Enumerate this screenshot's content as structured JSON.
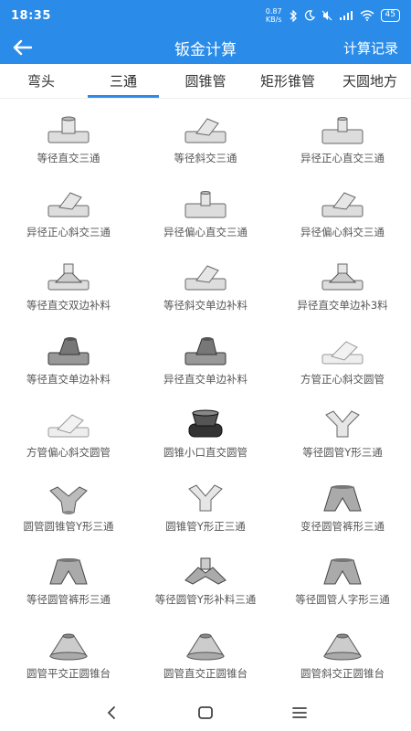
{
  "status": {
    "time": "18:35",
    "net_speed_value": "0.87",
    "net_speed_unit": "KB/s",
    "battery": "45"
  },
  "appbar": {
    "title": "钣金计算",
    "history_label": "计算记录"
  },
  "tabs": [
    {
      "label": "弯头"
    },
    {
      "label": "三通"
    },
    {
      "label": "圆锥管"
    },
    {
      "label": "矩形锥管"
    },
    {
      "label": "天圆地方"
    }
  ],
  "active_tab": "三通",
  "items": [
    {
      "label": "等径直交三通",
      "icon": "tee-straight-icon"
    },
    {
      "label": "等径斜交三通",
      "icon": "tee-oblique-icon"
    },
    {
      "label": "异径正心直交三通",
      "icon": "tee-reducing-icon"
    },
    {
      "label": "异径正心斜交三通",
      "icon": "tee-oblique-icon"
    },
    {
      "label": "异径偏心直交三通",
      "icon": "tee-reducing-icon"
    },
    {
      "label": "异径偏心斜交三通",
      "icon": "tee-oblique-icon"
    },
    {
      "label": "等径直交双边补料",
      "icon": "tee-patch-icon"
    },
    {
      "label": "等径斜交单边补料",
      "icon": "tee-oblique-icon"
    },
    {
      "label": "异径直交单边补3料",
      "icon": "tee-patch-icon"
    },
    {
      "label": "等径直交单边补料",
      "icon": "tee-solid-icon"
    },
    {
      "label": "异径直交单边补料",
      "icon": "tee-solid-icon"
    },
    {
      "label": "方管正心斜交圆管",
      "icon": "square-pipe-icon"
    },
    {
      "label": "方管偏心斜交圆管",
      "icon": "square-pipe-icon"
    },
    {
      "label": "圆锥小口直交圆管",
      "icon": "cone-pipe-icon"
    },
    {
      "label": "等径圆管Y形三通",
      "icon": "y-tee-icon"
    },
    {
      "label": "圆管圆锥管Y形三通",
      "icon": "y-cone-icon"
    },
    {
      "label": "圆锥管Y形正三通",
      "icon": "y-tee-icon"
    },
    {
      "label": "变径圆管裤形三通",
      "icon": "pants-tee-icon"
    },
    {
      "label": "等径圆管裤形三通",
      "icon": "pants-tee-icon"
    },
    {
      "label": "等径圆管Y形补料三通",
      "icon": "y-patch-icon"
    },
    {
      "label": "等径圆管人字形三通",
      "icon": "pants-tee-icon"
    },
    {
      "label": "圆管平交正圆锥台",
      "icon": "cone-frustum-icon"
    },
    {
      "label": "圆管直交正圆锥台",
      "icon": "cone-frustum-icon"
    },
    {
      "label": "圆管斜交正圆锥台",
      "icon": "cone-frustum-icon"
    }
  ]
}
